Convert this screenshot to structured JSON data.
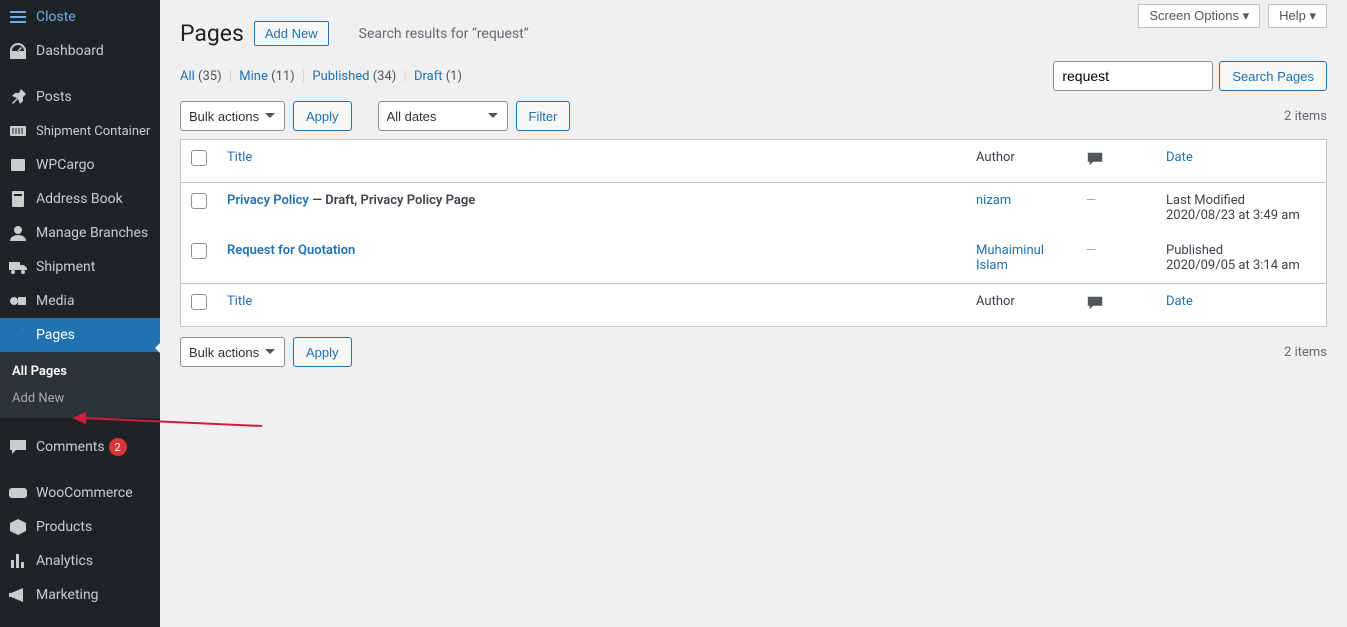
{
  "sidebar": {
    "items": [
      {
        "label": "Closte",
        "icon": "menu"
      },
      {
        "label": "Dashboard",
        "icon": "dashboard"
      },
      {
        "label": "Posts",
        "icon": "pin"
      },
      {
        "label": "Shipment Container",
        "icon": "container"
      },
      {
        "label": "WPCargo",
        "icon": "box"
      },
      {
        "label": "Address Book",
        "icon": "book"
      },
      {
        "label": "Manage Branches",
        "icon": "user"
      },
      {
        "label": "Shipment",
        "icon": "truck"
      },
      {
        "label": "Media",
        "icon": "media"
      },
      {
        "label": "Pages",
        "icon": "page"
      },
      {
        "label": "Comments",
        "icon": "comment",
        "badge": "2"
      },
      {
        "label": "WooCommerce",
        "icon": "woo"
      },
      {
        "label": "Products",
        "icon": "product"
      },
      {
        "label": "Analytics",
        "icon": "chart"
      },
      {
        "label": "Marketing",
        "icon": "megaphone"
      }
    ],
    "submenu": {
      "all_pages": "All Pages",
      "add_new": "Add New"
    }
  },
  "topbar": {
    "screen_options": "Screen Options",
    "help": "Help"
  },
  "header": {
    "title": "Pages",
    "add_new": "Add New",
    "subtitle_prefix": "Search results for ",
    "subtitle_query": "“request”"
  },
  "subsubsub": {
    "all": "All",
    "all_count": "(35)",
    "mine": "Mine",
    "mine_count": "(11)",
    "published": "Published",
    "published_count": "(34)",
    "draft": "Draft",
    "draft_count": "(1)"
  },
  "search": {
    "value": "request",
    "button": "Search Pages"
  },
  "bulk": {
    "placeholder": "Bulk actions",
    "apply": "Apply"
  },
  "datefilter": {
    "placeholder": "All dates",
    "filter": "Filter"
  },
  "items_count": "2 items",
  "columns": {
    "title": "Title",
    "author": "Author",
    "date": "Date"
  },
  "rows": [
    {
      "title": "Privacy Policy",
      "state": " — Draft, Privacy Policy Page",
      "author": "nizam",
      "comments": "—",
      "date_status": "Last Modified",
      "date_value": "2020/08/23 at 3:49 am"
    },
    {
      "title": "Request for Quotation",
      "state": "",
      "author": "Muhaiminul Islam",
      "comments": "—",
      "date_status": "Published",
      "date_value": "2020/09/05 at 3:14 am"
    }
  ]
}
